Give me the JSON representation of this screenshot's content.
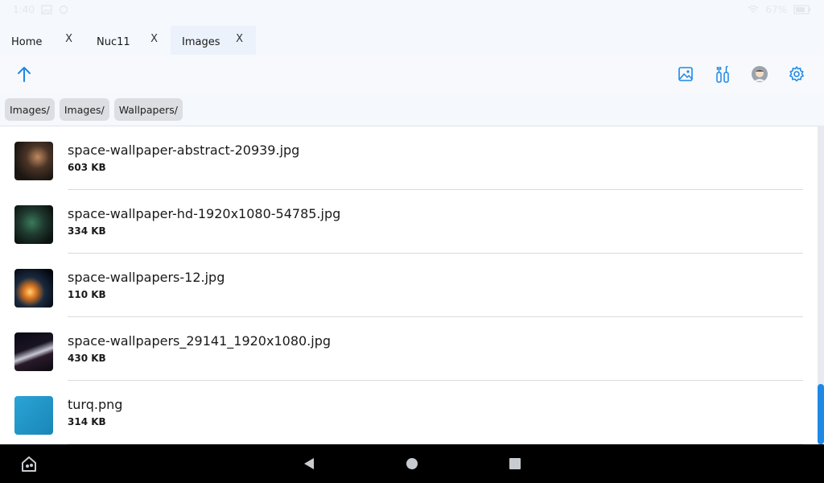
{
  "status_bar": {
    "time": "1:40",
    "battery": "67%"
  },
  "tabs": [
    {
      "label": "Home",
      "close": "X",
      "active": false
    },
    {
      "label": "Nuc11",
      "close": "X",
      "active": false
    },
    {
      "label": "Images",
      "close": "X",
      "active": true
    }
  ],
  "toolbar": {
    "up_icon": "arrow-up-icon",
    "right_icons": [
      "image-icon",
      "tools-icon",
      "avatar-icon",
      "gear-icon"
    ]
  },
  "breadcrumb": [
    "Images/",
    "Images/",
    "Wallpapers/"
  ],
  "files": [
    {
      "name": "space-wallpaper-abstract-20939.jpg",
      "size": "603 KB"
    },
    {
      "name": "space-wallpaper-hd-1920x1080-54785.jpg",
      "size": "334 KB"
    },
    {
      "name": "space-wallpapers-12.jpg",
      "size": "110 KB"
    },
    {
      "name": "space-wallpapers_29141_1920x1080.jpg",
      "size": "430 KB"
    },
    {
      "name": "turq.png",
      "size": "314 KB"
    }
  ],
  "colors": {
    "accent": "#1e88e5",
    "active_tab": "#ecf2fb",
    "breadcrumb_bg": "#dcdee2",
    "nav_bar": "#000000"
  },
  "nav_bar": {
    "icons": [
      "app-switch-icon",
      "back-icon",
      "home-icon",
      "recents-icon"
    ]
  }
}
